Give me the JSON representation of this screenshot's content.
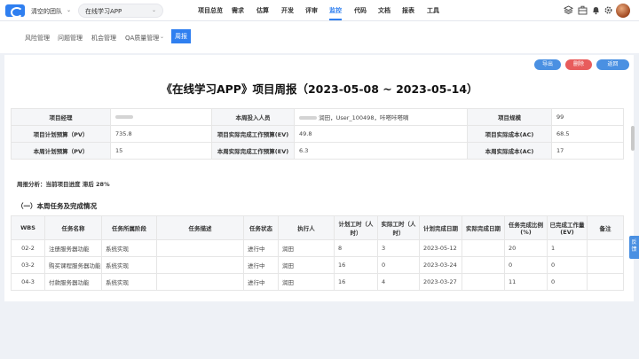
{
  "header": {
    "team": "清空的团队",
    "project": "在线学习APP",
    "nav": [
      "项目总览",
      "需求",
      "估算",
      "开发",
      "评审",
      "监控",
      "代码",
      "文档",
      "报表",
      "工具"
    ],
    "active_nav": "监控",
    "icons": [
      "cube-icon",
      "briefcase-icon",
      "bell-icon",
      "settings-icon"
    ]
  },
  "subnav": {
    "items": [
      "风险管理",
      "问题管理",
      "机会管理",
      "QA质量管理",
      "周报"
    ],
    "active": "周报"
  },
  "actions": {
    "export": "导出",
    "delete": "删除",
    "back": "返回"
  },
  "report": {
    "title": "《在线学习APP》项目周报（2023-05-08 ~ 2023-05-14）",
    "info": {
      "manager_label": "项目经理",
      "members_label": "本周投入人员",
      "members_value": "润田，User_100498，咔嗒咔嗒嘀",
      "scale_label": "项目规模",
      "scale_value": "99",
      "pv_label": "项目计划预算（PV）",
      "pv_value": "735.8",
      "ev_label": "项目实际完成工作预算(EV)",
      "ev_value": "49.8",
      "ac_label": "项目实际成本(AC)",
      "ac_value": "68.5",
      "week_pv_label": "本周计划预算（PV）",
      "week_pv_value": "15",
      "week_ev_label": "本周实际完成工作预算(EV)",
      "week_ev_value": "6.3",
      "week_ac_label": "本周实际成本(AC)",
      "week_ac_value": "17"
    },
    "analysis": "周报分析：当前项目进度 滞后 28%",
    "section_title": "（一）本周任务及完成情况",
    "table": {
      "headers": [
        "WBS",
        "任务名称",
        "任务所属阶段",
        "任务描述",
        "任务状态",
        "执行人",
        "计划工时（人时）",
        "实际工时（人时）",
        "计划完成日期",
        "实际完成日期",
        "任务完成比例(%)",
        "已完成工作量(EV)",
        "备注"
      ],
      "rows": [
        [
          "02-2",
          "注册服务器功能",
          "系统实现",
          "",
          "进行中",
          "润田",
          "8",
          "3",
          "2023-05-12",
          "",
          "20",
          "1",
          ""
        ],
        [
          "03-2",
          "购买课程服务器功能",
          "系统实现",
          "",
          "进行中",
          "润田",
          "16",
          "0",
          "2023-03-24",
          "",
          "0",
          "0",
          ""
        ],
        [
          "04-3",
          "付款服务器功能",
          "系统实现",
          "",
          "进行中",
          "润田",
          "16",
          "4",
          "2023-03-27",
          "",
          "11",
          "0",
          ""
        ]
      ]
    }
  },
  "side_tab": "反馈"
}
